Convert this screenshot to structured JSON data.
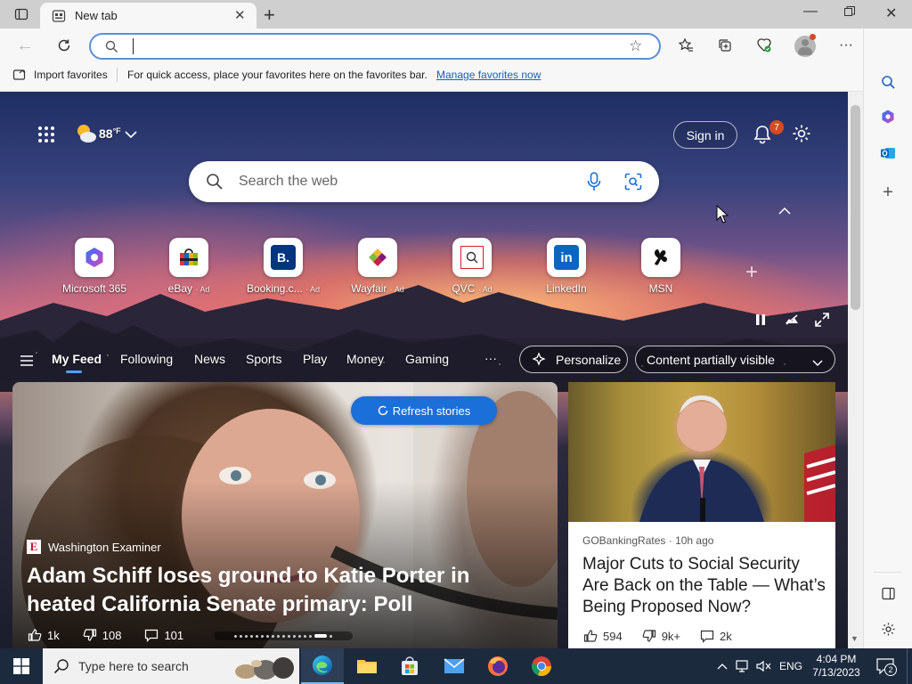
{
  "browser": {
    "tab_title": "New tab",
    "address_value": "",
    "favorites_bar": {
      "import_label": "Import favorites",
      "hint": "For quick access, place your favorites here on the favorites bar.",
      "manage_link": "Manage favorites now"
    }
  },
  "newtab": {
    "weather": {
      "temp": "88",
      "unit": "°F"
    },
    "sign_in_label": "Sign in",
    "notification_count": "7",
    "search_placeholder": "Search the web",
    "quick_links": [
      {
        "label": "Microsoft 365",
        "ad": ""
      },
      {
        "label": "eBay",
        "ad": "· Ad"
      },
      {
        "label": "Booking.c...",
        "ad": "· Ad"
      },
      {
        "label": "Wayfair",
        "ad": "· Ad"
      },
      {
        "label": "QVC",
        "ad": "· Ad"
      },
      {
        "label": "LinkedIn",
        "ad": ""
      },
      {
        "label": "MSN",
        "ad": ""
      }
    ],
    "nav": [
      "My Feed",
      "Following",
      "News",
      "Sports",
      "Play",
      "Money",
      "Gaming"
    ],
    "more": "···",
    "personalize_label": "Personalize",
    "content_dropdown": "Content partially visible",
    "refresh_label": "Refresh stories",
    "cards": [
      {
        "source": "Washington Examiner",
        "headline": "Adam Schiff loses ground to Katie Porter in heated California Senate primary: Poll",
        "likes": "1k",
        "dislikes": "108",
        "comments": "101"
      },
      {
        "source": "GOBankingRates",
        "time": "10h ago",
        "headline": "Major Cuts to Social Security Are Back on the Table — What’s Being Proposed Now?",
        "likes": "594",
        "dislikes": "9k+",
        "comments": "2k"
      }
    ]
  },
  "taskbar": {
    "search_placeholder": "Type here to search",
    "language": "ENG",
    "time": "4:04 PM",
    "date": "7/13/2023",
    "notifications": "2"
  },
  "colors": {
    "accent": "#1a6fd9",
    "link": "#1a5fb4",
    "badge": "#d64a23"
  }
}
